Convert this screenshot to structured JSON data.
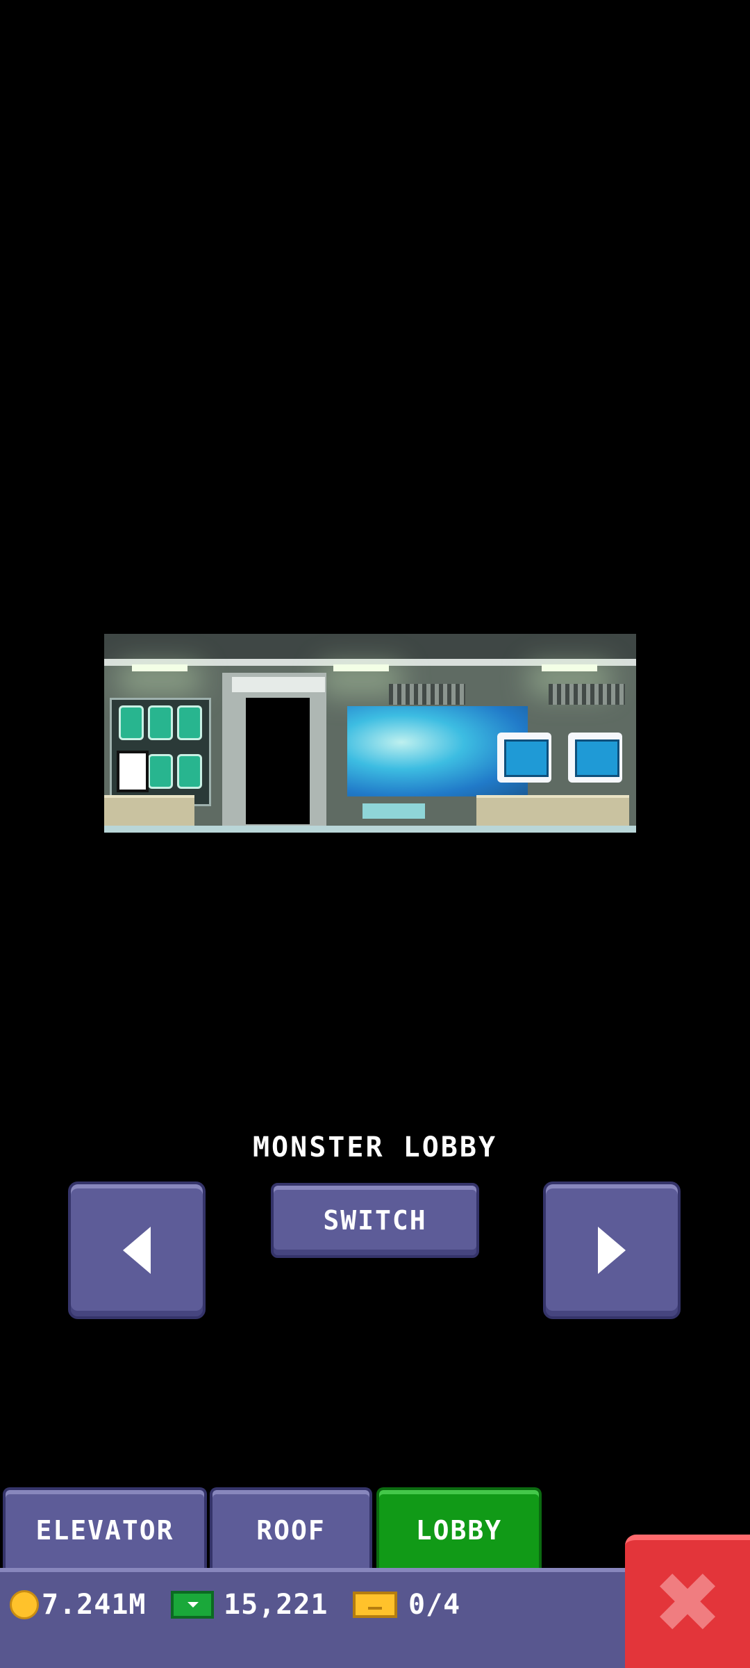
{
  "scene": {
    "name": "lobby-preview"
  },
  "title": "MONSTER LOBBY",
  "controls": {
    "switch_label": "SWITCH"
  },
  "tabs": [
    {
      "label": "ELEVATOR",
      "active": false
    },
    {
      "label": "ROOF",
      "active": false
    },
    {
      "label": "LOBBY",
      "active": true
    }
  ],
  "status": {
    "coins": "7.241M",
    "cash": "15,221",
    "tickets": "0/4"
  },
  "colors": {
    "button": "#5d5c98",
    "tab_active": "#119a17",
    "close": "#e3353a",
    "status_bar": "#58578f"
  }
}
